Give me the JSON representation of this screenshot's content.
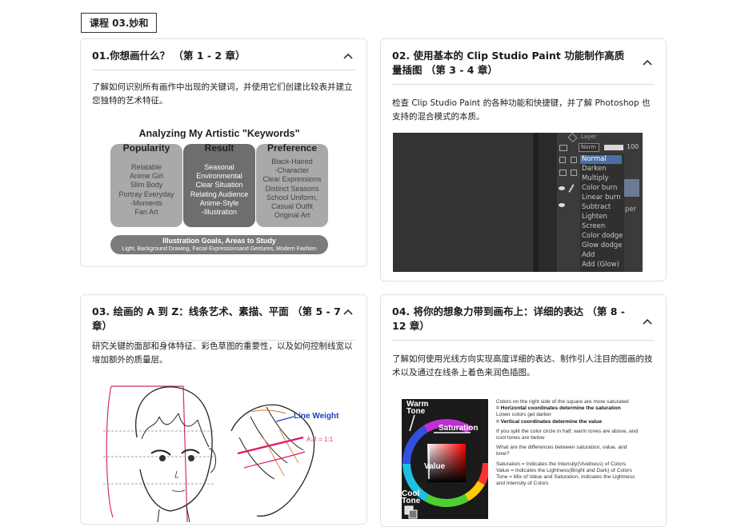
{
  "course_tag": "课程 03.妙和",
  "cards": [
    {
      "title": "01.你想画什么？ （第 1 - 2 章）",
      "description": "了解如何识别所有画作中出现的关键词，并使用它们创建比较表并建立您独特的艺术特征。",
      "image": {
        "title": "Analyzing My Artistic \"Keywords\"",
        "columns": [
          {
            "heading": "Popularity",
            "items": [
              "Relatable",
              "Anime Girl",
              "Slim Body",
              "Portray Everyday",
              "-Moments",
              "Fan Art"
            ]
          },
          {
            "heading": "Result",
            "items": [
              "Seasonal",
              "Environmental",
              "Clear Situation",
              "Relating Audience",
              "Anime-Style",
              "-Illustration"
            ]
          },
          {
            "heading": "Preference",
            "items": [
              "Black-Haired",
              "-Character",
              "Clear Expressions",
              "Distinct Seasons",
              "School Uniform,",
              "Casual Outfit",
              "Original Art"
            ]
          }
        ],
        "goals_title": "Illustration Goals, Areas to Study",
        "goals_text": "Light, Background Drawing, Facial Expressionsand Gestures, Modern Fashion"
      }
    },
    {
      "title": "02. 使用基本的 Clip Studio Paint 功能制作高质量插图 （第 3 - 4 章）",
      "description": "检查 Clip Studio Paint 的各种功能和快捷键，并了解 Photoshop 也支持的混合模式的本质。",
      "image": {
        "panel_label": "Layer",
        "mode_selected": "Norm",
        "opacity": "100",
        "side_label": "per",
        "blend_modes": [
          "Normal",
          "Darken",
          "Multiply",
          "Color burn",
          "Linear burn",
          "Subtract",
          "Lighten",
          "Screen",
          "Color dodge",
          "Glow dodge",
          "Add",
          "Add (Glow)"
        ]
      }
    },
    {
      "title": "03. 绘画的 A 到 Z：线条艺术、素描、平面 （第 5 - 7 章）",
      "description": "研究关键的面部和身体特征、彩色草图的重要性，以及如何控制线宽以增加额外的质量层。",
      "image": {
        "label": "Line Weight",
        "note": "A:B = 1:1"
      }
    },
    {
      "title": "04. 将你的想象力带到画布上：详细的表达 （第 8 - 12 章）",
      "description": "了解如何使用光线方向实现高度详细的表达、制作引人注目的图画的技术以及通过在线条上着色来润色插图。",
      "image": {
        "warm_label": [
          "Warm",
          "Tone"
        ],
        "cool_label": [
          "Cool",
          "Tone"
        ],
        "saturation_label": "Saturation",
        "value_label": "Value",
        "text_blocks": [
          {
            "lines": [
              "Colors on the right side of the square are more saturated"
            ],
            "bold": "= Horizontal coordinates determine the saturation"
          },
          {
            "lines": [
              "Lower colors get darker"
            ],
            "bold": "= Vertical coordinates determine the value"
          },
          {
            "lines": [
              "If you split the color circle in half, warm tones are above, and cool tones are below"
            ],
            "bold": ""
          },
          {
            "lines": [
              "What are the differences between saturation, value, and tone?"
            ],
            "bold": ""
          },
          {
            "lines": [
              "Saturation = Indicates the Intensity(Vividness) of Colors",
              "Value = Indicates the Lightness(Bright and Dark) of Colors",
              "Tone = Mix of Value and Saturation, Indicates the Lightness and Intensity of Colors"
            ],
            "bold": ""
          }
        ]
      }
    }
  ],
  "colors": {
    "card_border": "#e2e2e2",
    "col_light": "#a8a8a8",
    "col_dark": "#6f6f6f",
    "goal_bar": "#7b7b7b",
    "canvas_dark": "#2b2b2b",
    "menu_highlight": "#4a6fa5",
    "line_weight_blue": "#2040c0",
    "accent_pink": "#e0186a"
  }
}
